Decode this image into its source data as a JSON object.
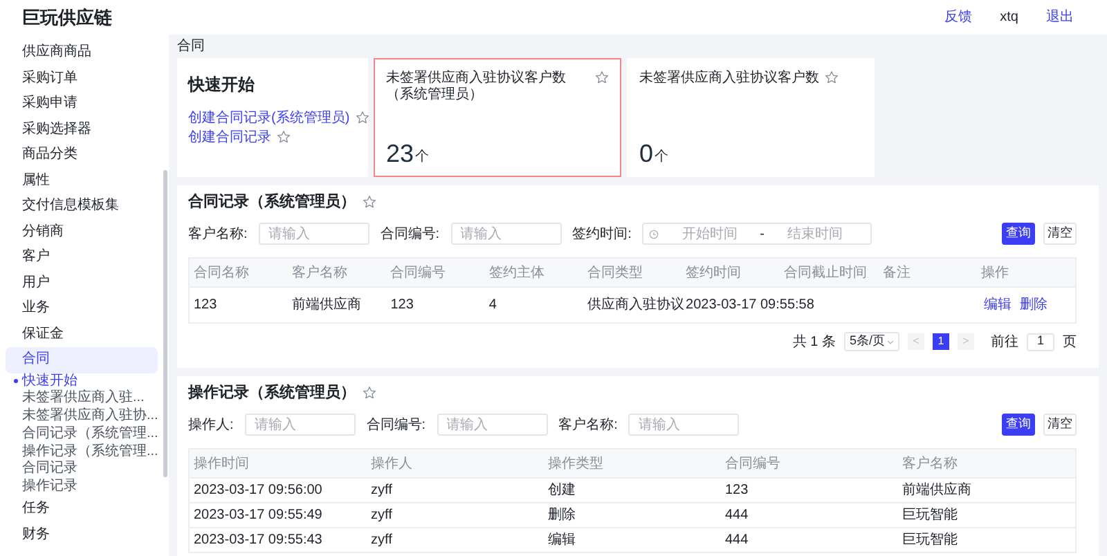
{
  "header": {
    "logo": "巨玩供应链",
    "links": [
      {
        "label": "反馈",
        "kind": "link"
      },
      {
        "label": "xtq",
        "kind": "user"
      },
      {
        "label": "退出",
        "kind": "link"
      }
    ]
  },
  "sidebar": {
    "items": [
      {
        "label": "供应商商品",
        "selected": false
      },
      {
        "label": "采购订单",
        "selected": false
      },
      {
        "label": "采购申请",
        "selected": false
      },
      {
        "label": "采购选择器",
        "selected": false
      },
      {
        "label": "商品分类",
        "selected": false
      },
      {
        "label": "属性",
        "selected": false
      },
      {
        "label": "交付信息模板集",
        "selected": false
      },
      {
        "label": "分销商",
        "selected": false
      },
      {
        "label": "客户",
        "selected": false
      },
      {
        "label": "用户",
        "selected": false
      },
      {
        "label": "业务",
        "selected": false
      },
      {
        "label": "保证金",
        "selected": false
      },
      {
        "label": "合同",
        "selected": true,
        "children": [
          {
            "label": "快速开始",
            "selected": true
          },
          {
            "label": "未签署供应商入驻...",
            "selected": false
          },
          {
            "label": "未签署供应商入驻协...",
            "selected": false
          },
          {
            "label": "合同记录（系统管理...",
            "selected": false
          },
          {
            "label": "操作记录（系统管理...",
            "selected": false
          },
          {
            "label": "合同记录",
            "selected": false
          },
          {
            "label": "操作记录",
            "selected": false
          }
        ]
      },
      {
        "label": "任务",
        "selected": false
      },
      {
        "label": "财务",
        "selected": false
      }
    ]
  },
  "breadcrumb": "合同",
  "quick_start": {
    "title": "快速开始",
    "links": [
      {
        "label": "创建合同记录(系统管理员)"
      },
      {
        "label": "创建合同记录"
      }
    ]
  },
  "stat_cards": [
    {
      "title": "未签署供应商入驻协议客户数（系统管理员）",
      "value": "23",
      "unit": "个",
      "selected": true
    },
    {
      "title": "未签署供应商入驻协议客户数",
      "value": "0",
      "unit": "个",
      "selected": false
    }
  ],
  "contract_records": {
    "title": "合同记录（系统管理员）",
    "filters": [
      {
        "kind": "text",
        "label": "客户名称:",
        "placeholder": "请输入"
      },
      {
        "kind": "text",
        "label": "合同编号:",
        "placeholder": "请输入"
      },
      {
        "kind": "daterange",
        "label": "签约时间:",
        "start_placeholder": "开始时间",
        "separator": "-",
        "end_placeholder": "结束时间"
      }
    ],
    "buttons": [
      {
        "label": "查询",
        "kind": "primary"
      },
      {
        "label": "清空",
        "kind": "default"
      }
    ],
    "columns": [
      "合同名称",
      "客户名称",
      "合同编号",
      "签约主体",
      "合同类型",
      "签约时间",
      "合同截止时间",
      "备注",
      "操作"
    ],
    "rows": [
      {
        "cells": [
          "123",
          "前端供应商",
          "123",
          "4",
          "供应商入驻协议",
          "2023-03-17 09:55:58",
          "",
          ""
        ],
        "actions": [
          "编辑",
          "删除"
        ]
      }
    ],
    "pagination": {
      "total": "共 1 条",
      "page_size": "5条/页",
      "prev": "<",
      "pages": [
        {
          "label": "1",
          "selected": true
        }
      ],
      "next": ">",
      "goto_label": "前往",
      "goto_value": "1",
      "goto_suffix": "页"
    }
  },
  "operation_records": {
    "title": "操作记录（系统管理员）",
    "filters": [
      {
        "kind": "text",
        "label": "操作人:",
        "placeholder": "请输入"
      },
      {
        "kind": "text",
        "label": "合同编号:",
        "placeholder": "请输入"
      },
      {
        "kind": "text",
        "label": "客户名称:",
        "placeholder": "请输入"
      }
    ],
    "buttons": [
      {
        "label": "查询",
        "kind": "primary"
      },
      {
        "label": "清空",
        "kind": "default"
      }
    ],
    "columns": [
      "操作时间",
      "操作人",
      "操作类型",
      "合同编号",
      "客户名称"
    ],
    "rows": [
      {
        "cells": [
          "2023-03-17 09:56:00",
          "zyff",
          "创建",
          "123",
          "前端供应商"
        ]
      },
      {
        "cells": [
          "2023-03-17 09:55:49",
          "zyff",
          "删除",
          "444",
          "巨玩智能"
        ]
      },
      {
        "cells": [
          "2023-03-17 09:55:43",
          "zyff",
          "编辑",
          "444",
          "巨玩智能"
        ]
      }
    ]
  }
}
